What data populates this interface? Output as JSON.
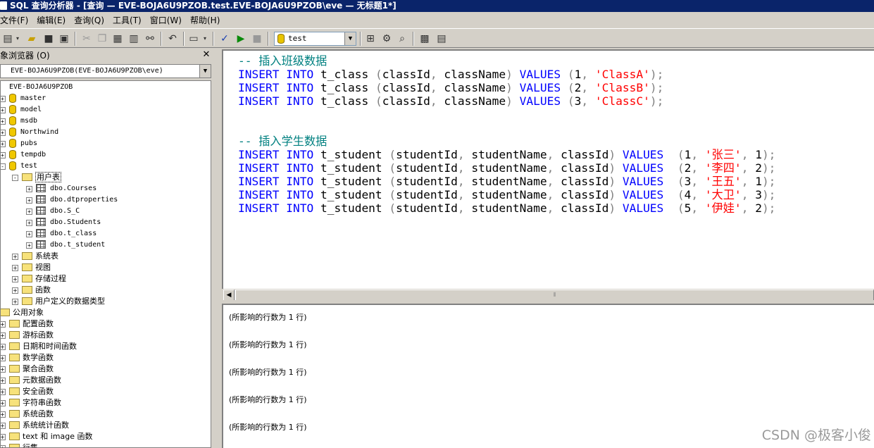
{
  "window": {
    "title": "SQL 查询分析器 - [查询 — EVE-BOJA6U9PZOB.test.EVE-BOJA6U9PZOB\\eve — 无标题1*]"
  },
  "menu": [
    "文件(F)",
    "编辑(E)",
    "查询(Q)",
    "工具(T)",
    "窗口(W)",
    "帮助(H)"
  ],
  "toolbar": {
    "database": "test",
    "icons": [
      "new-query-icon",
      "open-icon",
      "save-icon",
      "load-icon",
      "cut-icon",
      "copy-icon",
      "paste-icon",
      "clear-icon",
      "find-icon",
      "undo-icon",
      "grid-mode-icon",
      "parse-icon",
      "execute-icon",
      "stop-icon",
      "show-plan-icon",
      "trace-icon",
      "estimate-plan-icon",
      "object-browser-icon",
      "properties-icon"
    ]
  },
  "object_browser": {
    "title": "对象浏览器 (O)",
    "server_combo": "EVE-BOJA6U9PZOB(EVE-BOJA6U9PZOB\\eve)",
    "tree": [
      {
        "label": "EVE-BOJA6U9PZOB",
        "kind": "server"
      },
      {
        "label": "master",
        "kind": "db"
      },
      {
        "label": "model",
        "kind": "db"
      },
      {
        "label": "msdb",
        "kind": "db"
      },
      {
        "label": "Northwind",
        "kind": "db"
      },
      {
        "label": "pubs",
        "kind": "db"
      },
      {
        "label": "tempdb",
        "kind": "db"
      },
      {
        "label": "test",
        "kind": "db"
      },
      {
        "label": "用户表",
        "kind": "folder"
      },
      {
        "label": "dbo.Courses",
        "kind": "table"
      },
      {
        "label": "dbo.dtproperties",
        "kind": "table"
      },
      {
        "label": "dbo.S_C",
        "kind": "table"
      },
      {
        "label": "dbo.Students",
        "kind": "table"
      },
      {
        "label": "dbo.t_class",
        "kind": "table"
      },
      {
        "label": "dbo.t_student",
        "kind": "table"
      },
      {
        "label": "系统表",
        "kind": "folder"
      },
      {
        "label": "视图",
        "kind": "folder"
      },
      {
        "label": "存储过程",
        "kind": "folder"
      },
      {
        "label": "函数",
        "kind": "folder"
      },
      {
        "label": "用户定义的数据类型",
        "kind": "folder"
      },
      {
        "label": "公用对象",
        "kind": "folder"
      },
      {
        "label": "配置函数",
        "kind": "folder"
      },
      {
        "label": "游标函数",
        "kind": "folder"
      },
      {
        "label": "日期和时间函数",
        "kind": "folder"
      },
      {
        "label": "数学函数",
        "kind": "folder"
      },
      {
        "label": "聚合函数",
        "kind": "folder"
      },
      {
        "label": "元数据函数",
        "kind": "folder"
      },
      {
        "label": "安全函数",
        "kind": "folder"
      },
      {
        "label": "字符串函数",
        "kind": "folder"
      },
      {
        "label": "系统函数",
        "kind": "folder"
      },
      {
        "label": "系统统计函数",
        "kind": "folder"
      },
      {
        "label": "text 和 image 函数",
        "kind": "folder"
      },
      {
        "label": "行集",
        "kind": "folder"
      }
    ]
  },
  "editor": {
    "lines": [
      [
        {
          "t": "-- 插入班级数据",
          "c": "cm"
        }
      ],
      [
        {
          "t": "INSERT",
          "c": "kw"
        },
        {
          "t": " ",
          "c": "plain"
        },
        {
          "t": "INTO",
          "c": "kw"
        },
        {
          "t": " t_class ",
          "c": "plain"
        },
        {
          "t": "(",
          "c": "gr"
        },
        {
          "t": "classId",
          "c": "plain"
        },
        {
          "t": ", ",
          "c": "gr"
        },
        {
          "t": "className",
          "c": "plain"
        },
        {
          "t": ")",
          "c": "gr"
        },
        {
          "t": " ",
          "c": "plain"
        },
        {
          "t": "VALUES",
          "c": "kw"
        },
        {
          "t": " ",
          "c": "plain"
        },
        {
          "t": "(",
          "c": "gr"
        },
        {
          "t": "1",
          "c": "plain"
        },
        {
          "t": ", ",
          "c": "gr"
        },
        {
          "t": "'ClassA'",
          "c": "str"
        },
        {
          "t": ");",
          "c": "gr"
        }
      ],
      [
        {
          "t": "INSERT",
          "c": "kw"
        },
        {
          "t": " ",
          "c": "plain"
        },
        {
          "t": "INTO",
          "c": "kw"
        },
        {
          "t": " t_class ",
          "c": "plain"
        },
        {
          "t": "(",
          "c": "gr"
        },
        {
          "t": "classId",
          "c": "plain"
        },
        {
          "t": ", ",
          "c": "gr"
        },
        {
          "t": "className",
          "c": "plain"
        },
        {
          "t": ")",
          "c": "gr"
        },
        {
          "t": " ",
          "c": "plain"
        },
        {
          "t": "VALUES",
          "c": "kw"
        },
        {
          "t": " ",
          "c": "plain"
        },
        {
          "t": "(",
          "c": "gr"
        },
        {
          "t": "2",
          "c": "plain"
        },
        {
          "t": ", ",
          "c": "gr"
        },
        {
          "t": "'ClassB'",
          "c": "str"
        },
        {
          "t": ");",
          "c": "gr"
        }
      ],
      [
        {
          "t": "INSERT",
          "c": "kw"
        },
        {
          "t": " ",
          "c": "plain"
        },
        {
          "t": "INTO",
          "c": "kw"
        },
        {
          "t": " t_class ",
          "c": "plain"
        },
        {
          "t": "(",
          "c": "gr"
        },
        {
          "t": "classId",
          "c": "plain"
        },
        {
          "t": ", ",
          "c": "gr"
        },
        {
          "t": "className",
          "c": "plain"
        },
        {
          "t": ")",
          "c": "gr"
        },
        {
          "t": " ",
          "c": "plain"
        },
        {
          "t": "VALUES",
          "c": "kw"
        },
        {
          "t": " ",
          "c": "plain"
        },
        {
          "t": "(",
          "c": "gr"
        },
        {
          "t": "3",
          "c": "plain"
        },
        {
          "t": ", ",
          "c": "gr"
        },
        {
          "t": "'ClassC'",
          "c": "str"
        },
        {
          "t": ");",
          "c": "gr"
        }
      ],
      [],
      [],
      [
        {
          "t": "-- 插入学生数据",
          "c": "cm"
        }
      ],
      [
        {
          "t": "INSERT",
          "c": "kw"
        },
        {
          "t": " ",
          "c": "plain"
        },
        {
          "t": "INTO",
          "c": "kw"
        },
        {
          "t": " t_student ",
          "c": "plain"
        },
        {
          "t": "(",
          "c": "gr"
        },
        {
          "t": "studentId",
          "c": "plain"
        },
        {
          "t": ", ",
          "c": "gr"
        },
        {
          "t": "studentName",
          "c": "plain"
        },
        {
          "t": ", ",
          "c": "gr"
        },
        {
          "t": "classId",
          "c": "plain"
        },
        {
          "t": ")",
          "c": "gr"
        },
        {
          "t": " ",
          "c": "plain"
        },
        {
          "t": "VALUES",
          "c": "kw"
        },
        {
          "t": "  ",
          "c": "plain"
        },
        {
          "t": "(",
          "c": "gr"
        },
        {
          "t": "1",
          "c": "plain"
        },
        {
          "t": ", ",
          "c": "gr"
        },
        {
          "t": "'张三'",
          "c": "str"
        },
        {
          "t": ", ",
          "c": "gr"
        },
        {
          "t": "1",
          "c": "plain"
        },
        {
          "t": ");",
          "c": "gr"
        }
      ],
      [
        {
          "t": "INSERT",
          "c": "kw"
        },
        {
          "t": " ",
          "c": "plain"
        },
        {
          "t": "INTO",
          "c": "kw"
        },
        {
          "t": " t_student ",
          "c": "plain"
        },
        {
          "t": "(",
          "c": "gr"
        },
        {
          "t": "studentId",
          "c": "plain"
        },
        {
          "t": ", ",
          "c": "gr"
        },
        {
          "t": "studentName",
          "c": "plain"
        },
        {
          "t": ", ",
          "c": "gr"
        },
        {
          "t": "classId",
          "c": "plain"
        },
        {
          "t": ")",
          "c": "gr"
        },
        {
          "t": " ",
          "c": "plain"
        },
        {
          "t": "VALUES",
          "c": "kw"
        },
        {
          "t": "  ",
          "c": "plain"
        },
        {
          "t": "(",
          "c": "gr"
        },
        {
          "t": "2",
          "c": "plain"
        },
        {
          "t": ", ",
          "c": "gr"
        },
        {
          "t": "'李四'",
          "c": "str"
        },
        {
          "t": ", ",
          "c": "gr"
        },
        {
          "t": "2",
          "c": "plain"
        },
        {
          "t": ");",
          "c": "gr"
        }
      ],
      [
        {
          "t": "INSERT",
          "c": "kw"
        },
        {
          "t": " ",
          "c": "plain"
        },
        {
          "t": "INTO",
          "c": "kw"
        },
        {
          "t": " t_student ",
          "c": "plain"
        },
        {
          "t": "(",
          "c": "gr"
        },
        {
          "t": "studentId",
          "c": "plain"
        },
        {
          "t": ", ",
          "c": "gr"
        },
        {
          "t": "studentName",
          "c": "plain"
        },
        {
          "t": ", ",
          "c": "gr"
        },
        {
          "t": "classId",
          "c": "plain"
        },
        {
          "t": ")",
          "c": "gr"
        },
        {
          "t": " ",
          "c": "plain"
        },
        {
          "t": "VALUES",
          "c": "kw"
        },
        {
          "t": "  ",
          "c": "plain"
        },
        {
          "t": "(",
          "c": "gr"
        },
        {
          "t": "3",
          "c": "plain"
        },
        {
          "t": ", ",
          "c": "gr"
        },
        {
          "t": "'王五'",
          "c": "str"
        },
        {
          "t": ", ",
          "c": "gr"
        },
        {
          "t": "1",
          "c": "plain"
        },
        {
          "t": ");",
          "c": "gr"
        }
      ],
      [
        {
          "t": "INSERT",
          "c": "kw"
        },
        {
          "t": " ",
          "c": "plain"
        },
        {
          "t": "INTO",
          "c": "kw"
        },
        {
          "t": " t_student ",
          "c": "plain"
        },
        {
          "t": "(",
          "c": "gr"
        },
        {
          "t": "studentId",
          "c": "plain"
        },
        {
          "t": ", ",
          "c": "gr"
        },
        {
          "t": "studentName",
          "c": "plain"
        },
        {
          "t": ", ",
          "c": "gr"
        },
        {
          "t": "classId",
          "c": "plain"
        },
        {
          "t": ")",
          "c": "gr"
        },
        {
          "t": " ",
          "c": "plain"
        },
        {
          "t": "VALUES",
          "c": "kw"
        },
        {
          "t": "  ",
          "c": "plain"
        },
        {
          "t": "(",
          "c": "gr"
        },
        {
          "t": "4",
          "c": "plain"
        },
        {
          "t": ", ",
          "c": "gr"
        },
        {
          "t": "'大卫'",
          "c": "str"
        },
        {
          "t": ", ",
          "c": "gr"
        },
        {
          "t": "3",
          "c": "plain"
        },
        {
          "t": ");",
          "c": "gr"
        }
      ],
      [
        {
          "t": "INSERT",
          "c": "kw"
        },
        {
          "t": " ",
          "c": "plain"
        },
        {
          "t": "INTO",
          "c": "kw"
        },
        {
          "t": " t_student ",
          "c": "plain"
        },
        {
          "t": "(",
          "c": "gr"
        },
        {
          "t": "studentId",
          "c": "plain"
        },
        {
          "t": ", ",
          "c": "gr"
        },
        {
          "t": "studentName",
          "c": "plain"
        },
        {
          "t": ", ",
          "c": "gr"
        },
        {
          "t": "classId",
          "c": "plain"
        },
        {
          "t": ")",
          "c": "gr"
        },
        {
          "t": " ",
          "c": "plain"
        },
        {
          "t": "VALUES",
          "c": "kw"
        },
        {
          "t": "  ",
          "c": "plain"
        },
        {
          "t": "(",
          "c": "gr"
        },
        {
          "t": "5",
          "c": "plain"
        },
        {
          "t": ", ",
          "c": "gr"
        },
        {
          "t": "'伊娃'",
          "c": "str"
        },
        {
          "t": ", ",
          "c": "gr"
        },
        {
          "t": "2",
          "c": "plain"
        },
        {
          "t": ");",
          "c": "gr"
        }
      ]
    ]
  },
  "results": {
    "lines": [
      "(所影响的行数为 1 行)",
      "(所影响的行数为 1 行)",
      "(所影响的行数为 1 行)",
      "(所影响的行数为 1 行)",
      "(所影响的行数为 1 行)"
    ]
  },
  "watermark": "CSDN @极客小俊",
  "colors": {
    "keyword": "#0000ff",
    "comment": "#008080",
    "string": "#ff0000",
    "title_bar": "#0a246a"
  }
}
